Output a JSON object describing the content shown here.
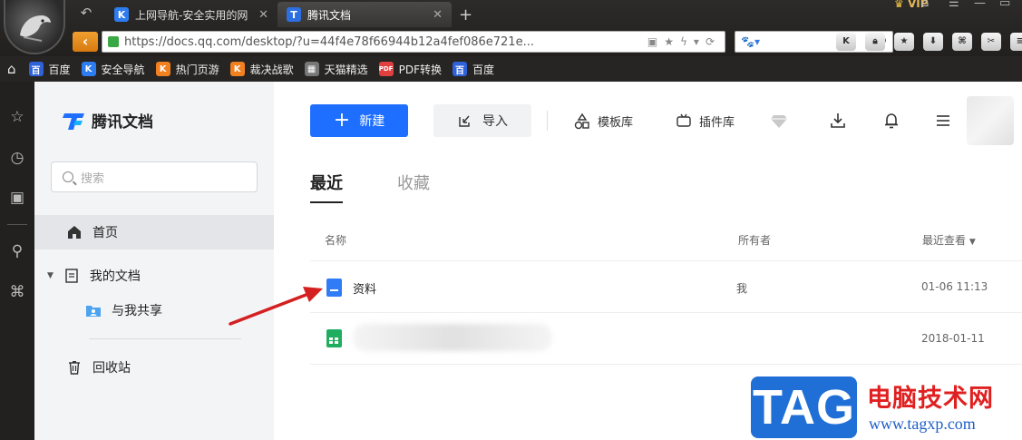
{
  "browser": {
    "tabs": [
      {
        "title": "上网导航-安全实用的网",
        "active": false
      },
      {
        "title": "腾讯文档",
        "active": true
      }
    ],
    "vip_label": "VIP",
    "url": "https://docs.qq.com/desktop/?u=44f4e78f66944b12a4fef086e721e...",
    "bookmarks": [
      "百度",
      "安全导航",
      "热门页游",
      "裁决战歌",
      "天猫精选",
      "PDF转换",
      "百度"
    ]
  },
  "sidebar": {
    "brand": "腾讯文档",
    "search_placeholder": "搜索",
    "items": [
      {
        "label": "首页",
        "active": true
      },
      {
        "label": "我的文档",
        "active": false
      },
      {
        "label": "与我共享",
        "active": false
      },
      {
        "label": "回收站",
        "active": false
      }
    ]
  },
  "toolbar": {
    "new_label": "新建",
    "import_label": "导入",
    "template_label": "模板库",
    "plugin_label": "插件库"
  },
  "tabs": [
    {
      "label": "最近",
      "active": true
    },
    {
      "label": "收藏",
      "active": false
    }
  ],
  "table": {
    "columns": {
      "name": "名称",
      "owner": "所有者",
      "recent": "最近查看"
    },
    "rows": [
      {
        "name": "资料",
        "owner": "我",
        "date": "01-06 11:13",
        "type": "doc"
      },
      {
        "name": "",
        "owner": "",
        "date": "2018-01-11",
        "type": "sheet"
      }
    ]
  },
  "watermark": {
    "tag": "TAG",
    "title": "电脑技术网",
    "site": "www.tagxp.com"
  },
  "colors": {
    "primary": "#1e6fff",
    "arrow": "#d42020",
    "doc_icon": "#2f7cf6",
    "sheet_icon": "#1fae5f"
  }
}
